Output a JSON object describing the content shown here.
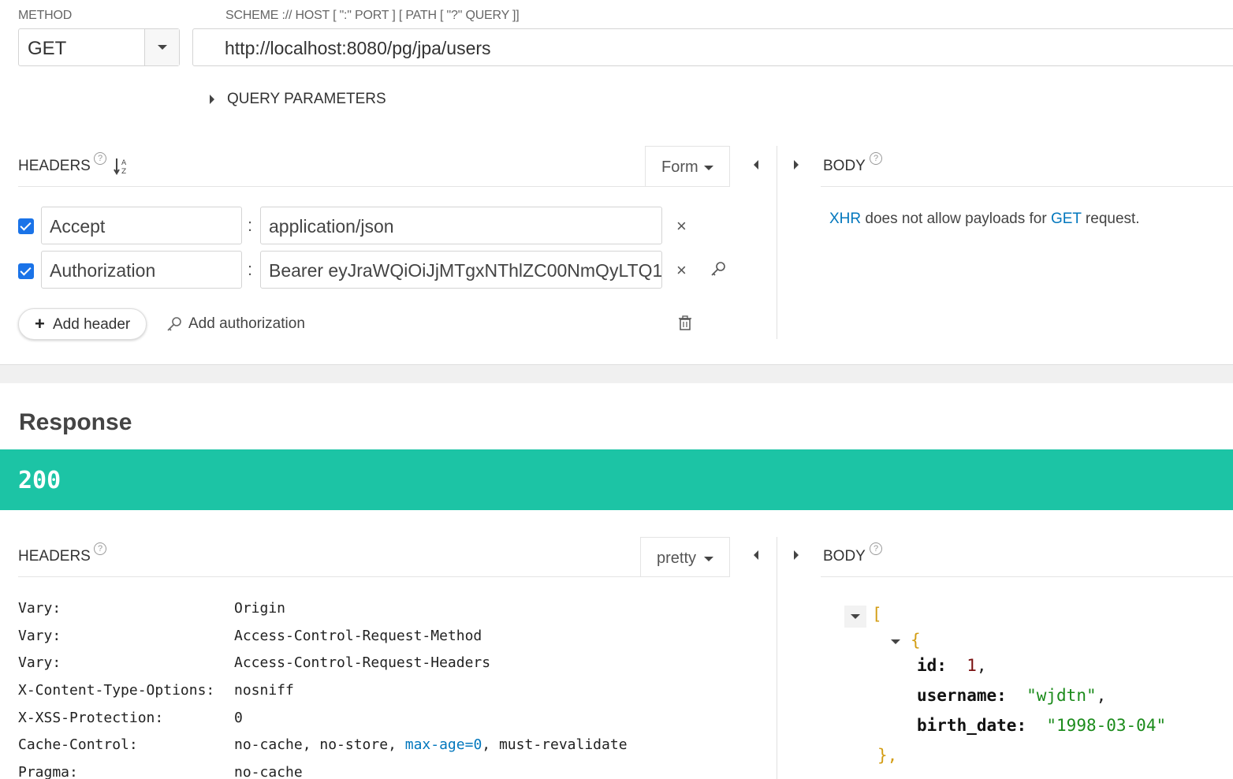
{
  "request": {
    "method_label": "METHOD",
    "method_value": "GET",
    "url_label": "SCHEME :// HOST [ \":\" PORT ] [ PATH [ \"?\" QUERY ]]",
    "url_value": "http://localhost:8080/pg/jpa/users",
    "query_params_label": "QUERY PARAMETERS",
    "headers_title": "HEADERS",
    "help_glyph": "?",
    "sort_icon_text": "A Z",
    "form_dropdown": "Form",
    "body_title": "BODY",
    "body_message": {
      "xhr": "XHR",
      "middle": " does not allow payloads for ",
      "get": "GET",
      "end": " request."
    },
    "headers": [
      {
        "enabled": true,
        "name": "Accept",
        "value": "application/json"
      },
      {
        "enabled": true,
        "name": "Authorization",
        "value": "Bearer eyJraWQiOiJjMTgxNThlZC00NmQyLTQ1"
      }
    ],
    "colon": ":",
    "remove_glyph": "×",
    "add_header_label": "Add header",
    "add_authorization_label": "Add authorization"
  },
  "response": {
    "title": "Response",
    "status_code": "200",
    "headers_title": "HEADERS",
    "pretty_dropdown": "pretty",
    "body_title": "BODY",
    "headers": [
      {
        "key": "Vary:",
        "value": "Origin"
      },
      {
        "key": "Vary:",
        "value": "Access-Control-Request-Method"
      },
      {
        "key": "Vary:",
        "value": "Access-Control-Request-Headers"
      },
      {
        "key": "X-Content-Type-Options:",
        "value": "nosniff"
      },
      {
        "key": "X-XSS-Protection:",
        "value": "0"
      },
      {
        "key": "Cache-Control:",
        "value_parts": [
          "no-cache, no-store, ",
          "max-age=0",
          ", must-revalidate"
        ]
      },
      {
        "key": "Pragma:",
        "value": "no-cache"
      }
    ],
    "body_json": {
      "open_array": "[",
      "open_object": "{",
      "fields": [
        {
          "key": "id",
          "value": "1",
          "type": "number"
        },
        {
          "key": "username",
          "value": "\"wjdtn\"",
          "type": "string"
        },
        {
          "key": "birth_date",
          "value": "\"1998-03-04\"",
          "type": "string"
        }
      ],
      "close_object": "},"
    }
  },
  "colors": {
    "status_green": "#1cc4a5",
    "checkbox_blue": "#1a73e8",
    "link_blue": "#0277bd",
    "json_string": "#1b8b1b",
    "json_number": "#7a1010",
    "json_bracket": "#d39d14"
  }
}
